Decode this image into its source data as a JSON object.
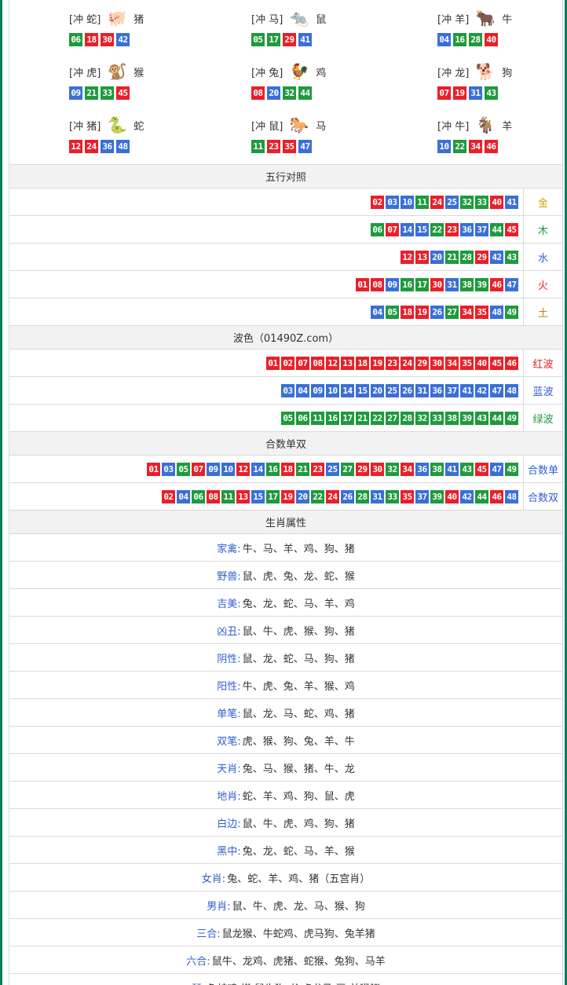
{
  "zodiac_grid": [
    {
      "name": "牛",
      "tag": "[冲 羊]",
      "icon": "ox-icon",
      "glyph": "🐂",
      "balls": [
        {
          "n": "04",
          "c": "u"
        },
        {
          "n": "16",
          "c": "g"
        },
        {
          "n": "28",
          "c": "g"
        },
        {
          "n": "40",
          "c": "r"
        }
      ]
    },
    {
      "name": "鼠",
      "tag": "[冲 马]",
      "icon": "rat-icon",
      "glyph": "🐀",
      "balls": [
        {
          "n": "05",
          "c": "g"
        },
        {
          "n": "17",
          "c": "g"
        },
        {
          "n": "29",
          "c": "r"
        },
        {
          "n": "41",
          "c": "u"
        }
      ]
    },
    {
      "name": "猪",
      "tag": "[冲 蛇]",
      "icon": "pig-icon",
      "glyph": "🐖",
      "balls": [
        {
          "n": "06",
          "c": "g"
        },
        {
          "n": "18",
          "c": "r"
        },
        {
          "n": "30",
          "c": "r"
        },
        {
          "n": "42",
          "c": "u"
        }
      ]
    },
    {
      "name": "狗",
      "tag": "[冲 龙]",
      "icon": "dog-icon",
      "glyph": "🐕",
      "balls": [
        {
          "n": "07",
          "c": "r"
        },
        {
          "n": "19",
          "c": "r"
        },
        {
          "n": "31",
          "c": "u"
        },
        {
          "n": "43",
          "c": "g"
        }
      ]
    },
    {
      "name": "鸡",
      "tag": "[冲 兔]",
      "icon": "rooster-icon",
      "glyph": "🐓",
      "balls": [
        {
          "n": "08",
          "c": "r"
        },
        {
          "n": "20",
          "c": "u"
        },
        {
          "n": "32",
          "c": "g"
        },
        {
          "n": "44",
          "c": "g"
        }
      ]
    },
    {
      "name": "猴",
      "tag": "[冲 虎]",
      "icon": "monkey-icon",
      "glyph": "🐒",
      "balls": [
        {
          "n": "09",
          "c": "u"
        },
        {
          "n": "21",
          "c": "g"
        },
        {
          "n": "33",
          "c": "g"
        },
        {
          "n": "45",
          "c": "r"
        }
      ]
    },
    {
      "name": "羊",
      "tag": "[冲 牛]",
      "icon": "goat-icon",
      "glyph": "🐐",
      "balls": [
        {
          "n": "10",
          "c": "u"
        },
        {
          "n": "22",
          "c": "g"
        },
        {
          "n": "34",
          "c": "r"
        },
        {
          "n": "46",
          "c": "r"
        }
      ]
    },
    {
      "name": "马",
      "tag": "[冲 鼠]",
      "icon": "horse-icon",
      "glyph": "🐎",
      "balls": [
        {
          "n": "11",
          "c": "g"
        },
        {
          "n": "23",
          "c": "r"
        },
        {
          "n": "35",
          "c": "r"
        },
        {
          "n": "47",
          "c": "u"
        }
      ]
    },
    {
      "name": "蛇",
      "tag": "[冲 猪]",
      "icon": "snake-icon",
      "glyph": "🐍",
      "balls": [
        {
          "n": "12",
          "c": "r"
        },
        {
          "n": "24",
          "c": "r"
        },
        {
          "n": "36",
          "c": "u"
        },
        {
          "n": "48",
          "c": "u"
        }
      ]
    }
  ],
  "wuxing": {
    "title": "五行对照",
    "rows": [
      {
        "label": "金",
        "color": "#c9a400",
        "balls": [
          {
            "n": "02",
            "c": "r"
          },
          {
            "n": "03",
            "c": "u"
          },
          {
            "n": "10",
            "c": "u"
          },
          {
            "n": "11",
            "c": "g"
          },
          {
            "n": "24",
            "c": "r"
          },
          {
            "n": "25",
            "c": "u"
          },
          {
            "n": "32",
            "c": "g"
          },
          {
            "n": "33",
            "c": "g"
          },
          {
            "n": "40",
            "c": "r"
          },
          {
            "n": "41",
            "c": "u"
          }
        ]
      },
      {
        "label": "木",
        "color": "#1f9a3e",
        "balls": [
          {
            "n": "06",
            "c": "g"
          },
          {
            "n": "07",
            "c": "r"
          },
          {
            "n": "14",
            "c": "u"
          },
          {
            "n": "15",
            "c": "u"
          },
          {
            "n": "22",
            "c": "g"
          },
          {
            "n": "23",
            "c": "r"
          },
          {
            "n": "36",
            "c": "u"
          },
          {
            "n": "37",
            "c": "u"
          },
          {
            "n": "44",
            "c": "g"
          },
          {
            "n": "45",
            "c": "r"
          }
        ]
      },
      {
        "label": "水",
        "color": "#2f5fd0",
        "balls": [
          {
            "n": "12",
            "c": "r"
          },
          {
            "n": "13",
            "c": "r"
          },
          {
            "n": "20",
            "c": "u"
          },
          {
            "n": "21",
            "c": "g"
          },
          {
            "n": "28",
            "c": "g"
          },
          {
            "n": "29",
            "c": "r"
          },
          {
            "n": "42",
            "c": "u"
          },
          {
            "n": "43",
            "c": "g"
          }
        ]
      },
      {
        "label": "火",
        "color": "#e8202a",
        "balls": [
          {
            "n": "01",
            "c": "r"
          },
          {
            "n": "08",
            "c": "r"
          },
          {
            "n": "09",
            "c": "u"
          },
          {
            "n": "16",
            "c": "g"
          },
          {
            "n": "17",
            "c": "g"
          },
          {
            "n": "30",
            "c": "r"
          },
          {
            "n": "31",
            "c": "u"
          },
          {
            "n": "38",
            "c": "g"
          },
          {
            "n": "39",
            "c": "g"
          },
          {
            "n": "46",
            "c": "r"
          },
          {
            "n": "47",
            "c": "u"
          }
        ]
      },
      {
        "label": "土",
        "color": "#b8860b",
        "balls": [
          {
            "n": "04",
            "c": "u"
          },
          {
            "n": "05",
            "c": "g"
          },
          {
            "n": "18",
            "c": "r"
          },
          {
            "n": "19",
            "c": "r"
          },
          {
            "n": "26",
            "c": "u"
          },
          {
            "n": "27",
            "c": "g"
          },
          {
            "n": "34",
            "c": "r"
          },
          {
            "n": "35",
            "c": "r"
          },
          {
            "n": "48",
            "c": "u"
          },
          {
            "n": "49",
            "c": "g"
          }
        ]
      }
    ]
  },
  "bose": {
    "title": "波色（01490Z.com）",
    "rows": [
      {
        "label": "红波",
        "color": "#e8202a",
        "balls": [
          {
            "n": "01",
            "c": "r"
          },
          {
            "n": "02",
            "c": "r"
          },
          {
            "n": "07",
            "c": "r"
          },
          {
            "n": "08",
            "c": "r"
          },
          {
            "n": "12",
            "c": "r"
          },
          {
            "n": "13",
            "c": "r"
          },
          {
            "n": "18",
            "c": "r"
          },
          {
            "n": "19",
            "c": "r"
          },
          {
            "n": "23",
            "c": "r"
          },
          {
            "n": "24",
            "c": "r"
          },
          {
            "n": "29",
            "c": "r"
          },
          {
            "n": "30",
            "c": "r"
          },
          {
            "n": "34",
            "c": "r"
          },
          {
            "n": "35",
            "c": "r"
          },
          {
            "n": "40",
            "c": "r"
          },
          {
            "n": "45",
            "c": "r"
          },
          {
            "n": "46",
            "c": "r"
          }
        ]
      },
      {
        "label": "蓝波",
        "color": "#2f5fd0",
        "balls": [
          {
            "n": "03",
            "c": "u"
          },
          {
            "n": "04",
            "c": "u"
          },
          {
            "n": "09",
            "c": "u"
          },
          {
            "n": "10",
            "c": "u"
          },
          {
            "n": "14",
            "c": "u"
          },
          {
            "n": "15",
            "c": "u"
          },
          {
            "n": "20",
            "c": "u"
          },
          {
            "n": "25",
            "c": "u"
          },
          {
            "n": "26",
            "c": "u"
          },
          {
            "n": "31",
            "c": "u"
          },
          {
            "n": "36",
            "c": "u"
          },
          {
            "n": "37",
            "c": "u"
          },
          {
            "n": "41",
            "c": "u"
          },
          {
            "n": "42",
            "c": "u"
          },
          {
            "n": "47",
            "c": "u"
          },
          {
            "n": "48",
            "c": "u"
          }
        ]
      },
      {
        "label": "绿波",
        "color": "#1f9a3e",
        "balls": [
          {
            "n": "05",
            "c": "g"
          },
          {
            "n": "06",
            "c": "g"
          },
          {
            "n": "11",
            "c": "g"
          },
          {
            "n": "16",
            "c": "g"
          },
          {
            "n": "17",
            "c": "g"
          },
          {
            "n": "21",
            "c": "g"
          },
          {
            "n": "22",
            "c": "g"
          },
          {
            "n": "27",
            "c": "g"
          },
          {
            "n": "28",
            "c": "g"
          },
          {
            "n": "32",
            "c": "g"
          },
          {
            "n": "33",
            "c": "g"
          },
          {
            "n": "38",
            "c": "g"
          },
          {
            "n": "39",
            "c": "g"
          },
          {
            "n": "43",
            "c": "g"
          },
          {
            "n": "44",
            "c": "g"
          },
          {
            "n": "49",
            "c": "g"
          }
        ]
      }
    ]
  },
  "heshu": {
    "title": "合数单双",
    "rows": [
      {
        "label": "合数单",
        "color": "#2f5fd0",
        "balls": [
          {
            "n": "01",
            "c": "r"
          },
          {
            "n": "03",
            "c": "u"
          },
          {
            "n": "05",
            "c": "g"
          },
          {
            "n": "07",
            "c": "r"
          },
          {
            "n": "09",
            "c": "u"
          },
          {
            "n": "10",
            "c": "u"
          },
          {
            "n": "12",
            "c": "r"
          },
          {
            "n": "14",
            "c": "u"
          },
          {
            "n": "16",
            "c": "g"
          },
          {
            "n": "18",
            "c": "r"
          },
          {
            "n": "21",
            "c": "g"
          },
          {
            "n": "23",
            "c": "r"
          },
          {
            "n": "25",
            "c": "u"
          },
          {
            "n": "27",
            "c": "g"
          },
          {
            "n": "29",
            "c": "r"
          },
          {
            "n": "30",
            "c": "r"
          },
          {
            "n": "32",
            "c": "g"
          },
          {
            "n": "34",
            "c": "r"
          },
          {
            "n": "36",
            "c": "u"
          },
          {
            "n": "38",
            "c": "g"
          },
          {
            "n": "41",
            "c": "u"
          },
          {
            "n": "43",
            "c": "g"
          },
          {
            "n": "45",
            "c": "r"
          },
          {
            "n": "47",
            "c": "u"
          },
          {
            "n": "49",
            "c": "g"
          }
        ]
      },
      {
        "label": "合数双",
        "color": "#2f5fd0",
        "balls": [
          {
            "n": "02",
            "c": "r"
          },
          {
            "n": "04",
            "c": "u"
          },
          {
            "n": "06",
            "c": "g"
          },
          {
            "n": "08",
            "c": "r"
          },
          {
            "n": "11",
            "c": "g"
          },
          {
            "n": "13",
            "c": "r"
          },
          {
            "n": "15",
            "c": "u"
          },
          {
            "n": "17",
            "c": "g"
          },
          {
            "n": "19",
            "c": "r"
          },
          {
            "n": "20",
            "c": "u"
          },
          {
            "n": "22",
            "c": "g"
          },
          {
            "n": "24",
            "c": "r"
          },
          {
            "n": "26",
            "c": "u"
          },
          {
            "n": "28",
            "c": "g"
          },
          {
            "n": "31",
            "c": "u"
          },
          {
            "n": "33",
            "c": "g"
          },
          {
            "n": "35",
            "c": "r"
          },
          {
            "n": "37",
            "c": "u"
          },
          {
            "n": "39",
            "c": "g"
          },
          {
            "n": "40",
            "c": "r"
          },
          {
            "n": "42",
            "c": "u"
          },
          {
            "n": "44",
            "c": "g"
          },
          {
            "n": "46",
            "c": "r"
          },
          {
            "n": "48",
            "c": "u"
          }
        ]
      }
    ]
  },
  "shengxiao": {
    "title": "生肖属性",
    "rows": [
      {
        "k": "家禽:",
        "v": "牛、马、羊、鸡、狗、猪"
      },
      {
        "k": "野兽:",
        "v": "鼠、虎、兔、龙、蛇、猴"
      },
      {
        "k": "吉美:",
        "v": "兔、龙、蛇、马、羊、鸡"
      },
      {
        "k": "凶丑:",
        "v": "鼠、牛、虎、猴、狗、猪"
      },
      {
        "k": "阴性:",
        "v": "鼠、龙、蛇、马、狗、猪"
      },
      {
        "k": "阳性:",
        "v": "牛、虎、兔、羊、猴、鸡"
      },
      {
        "k": "单笔:",
        "v": "鼠、龙、马、蛇、鸡、猪"
      },
      {
        "k": "双笔:",
        "v": "虎、猴、狗、兔、羊、牛"
      },
      {
        "k": "天肖:",
        "v": "兔、马、猴、猪、牛、龙"
      },
      {
        "k": "地肖:",
        "v": "蛇、羊、鸡、狗、鼠、虎"
      },
      {
        "k": "白边:",
        "v": "鼠、牛、虎、鸡、狗、猪"
      },
      {
        "k": "黑中:",
        "v": "兔、龙、蛇、马、羊、猴"
      },
      {
        "k": "女肖:",
        "v": "兔、蛇、羊、鸡、猪（五宫肖）"
      },
      {
        "k": "男肖:",
        "v": "鼠、牛、虎、龙、马、猴、狗"
      },
      {
        "k": "三合:",
        "v": "鼠龙猴、牛蛇鸡、虎马狗、兔羊猪"
      },
      {
        "k": "六合:",
        "v": "鼠牛、龙鸡、虎猪、蛇猴、兔狗、马羊"
      },
      {
        "k": "琴:",
        "v": "兔蛇鸡  棋:鼠牛狗  书:虎龙马  画:羊猴猪"
      }
    ]
  }
}
